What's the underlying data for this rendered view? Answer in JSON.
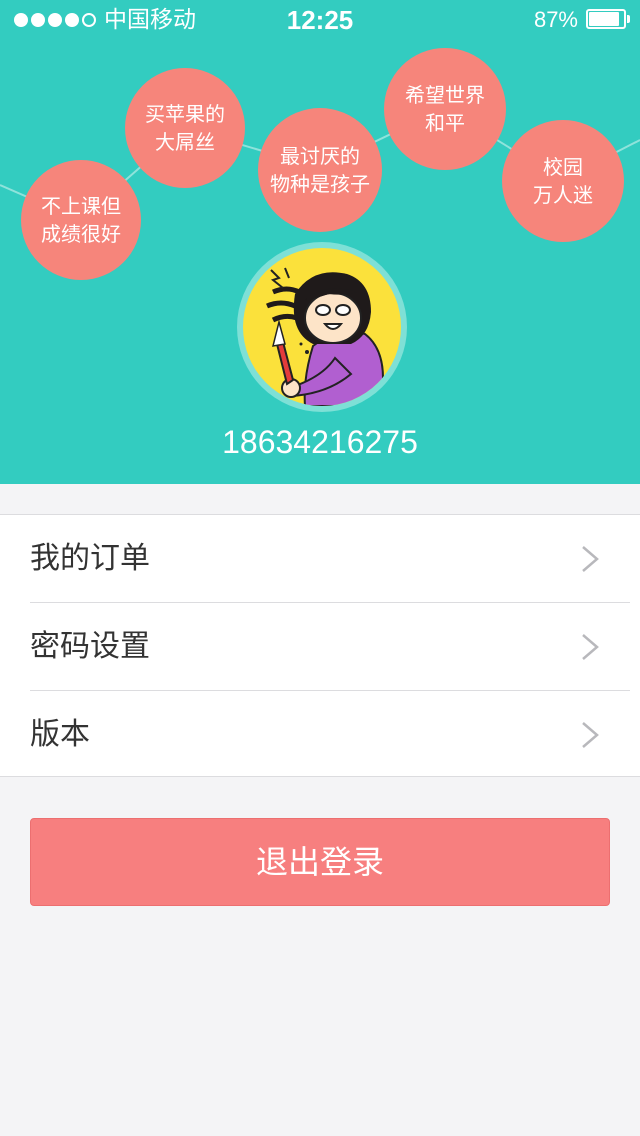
{
  "status_bar": {
    "carrier": "中国移动",
    "time": "12:25",
    "battery_percent_label": "87%",
    "battery_level": 0.87,
    "signal_bars_filled": 4,
    "signal_bars_total": 5
  },
  "tags": [
    "不上课但\n成绩很好",
    "买苹果的\n大屌丝",
    "最讨厌的\n物种是孩子",
    "希望世界\n和平",
    "校园\n万人迷"
  ],
  "profile": {
    "phone": "18634216275"
  },
  "menu": {
    "items": [
      {
        "label": "我的订单"
      },
      {
        "label": "密码设置"
      },
      {
        "label": "版本"
      }
    ]
  },
  "logout": {
    "label": "退出登录"
  },
  "colors": {
    "header_bg": "#33ccc0",
    "bubble": "#f6857b",
    "logout_bg": "#f77f7f",
    "page_bg": "#f4f4f6"
  },
  "icons": {
    "chevron": "chevron-right-icon",
    "avatar": "cartoon-avatar-icon"
  }
}
